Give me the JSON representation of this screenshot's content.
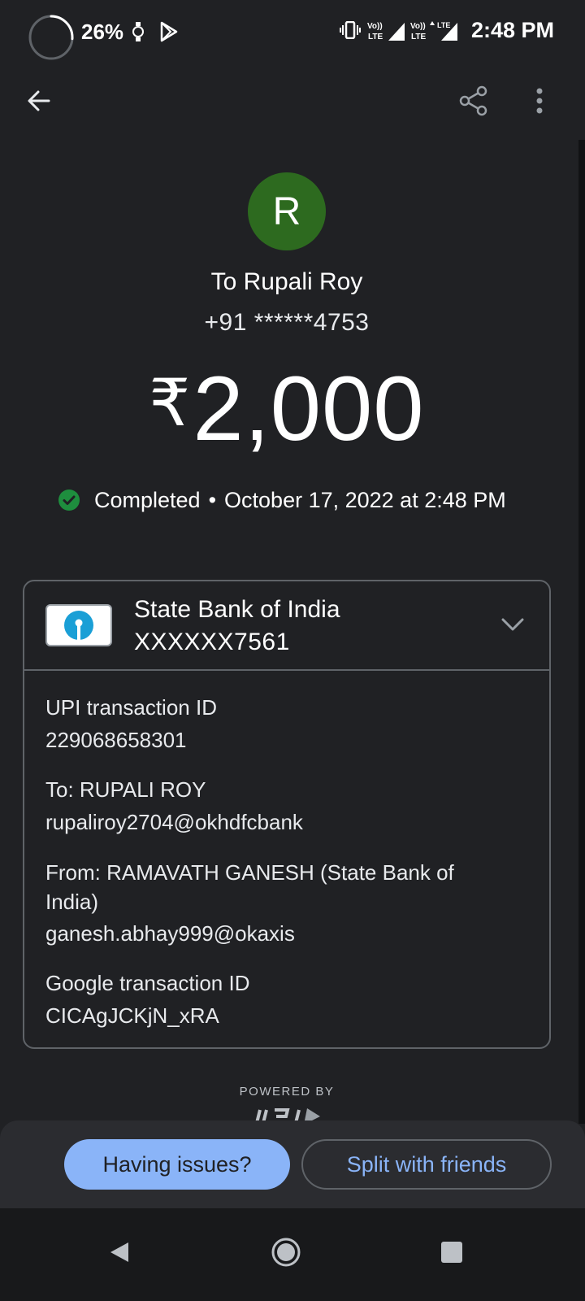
{
  "status_bar": {
    "battery_percent": "26%",
    "battery_level": 0.26,
    "time": "2:48 PM",
    "network_labels": [
      "Vo))",
      "LTE",
      "Vo))",
      "LTE",
      "LTE"
    ]
  },
  "top_bar": {
    "back_icon": "arrow-left-icon",
    "share_icon": "share-icon",
    "more_icon": "more-vert-icon"
  },
  "recipient": {
    "avatar_initial": "R",
    "avatar_color": "#2d6a1f",
    "name": "To Rupali Roy",
    "phone": "+91 ******4753"
  },
  "amount": {
    "currency": "₹",
    "value": "2,000"
  },
  "status": {
    "label": "Completed",
    "separator": "•",
    "datetime": "October 17, 2022 at 2:48 PM",
    "color": "#1e8e3e"
  },
  "bank": {
    "name": "State Bank of India",
    "account": "XXXXXX7561"
  },
  "details": {
    "upi_id_label": "UPI transaction ID",
    "upi_id_value": "229068658301",
    "to_label": "To: RUPALI ROY",
    "to_value": "rupaliroy2704@okhdfcbank",
    "from_label_line1": "From: RAMAVATH  GANESH (State Bank of",
    "from_label_line2": "India)",
    "from_value": "ganesh.abhay999@okaxis",
    "google_id_label": "Google transaction ID",
    "google_id_value": "CICAgJCKjN_xRA"
  },
  "footer": {
    "powered_by": "POWERED BY"
  },
  "actions": {
    "issues_label": "Having issues?",
    "split_label": "Split with friends",
    "accent": "#8ab4f8"
  }
}
